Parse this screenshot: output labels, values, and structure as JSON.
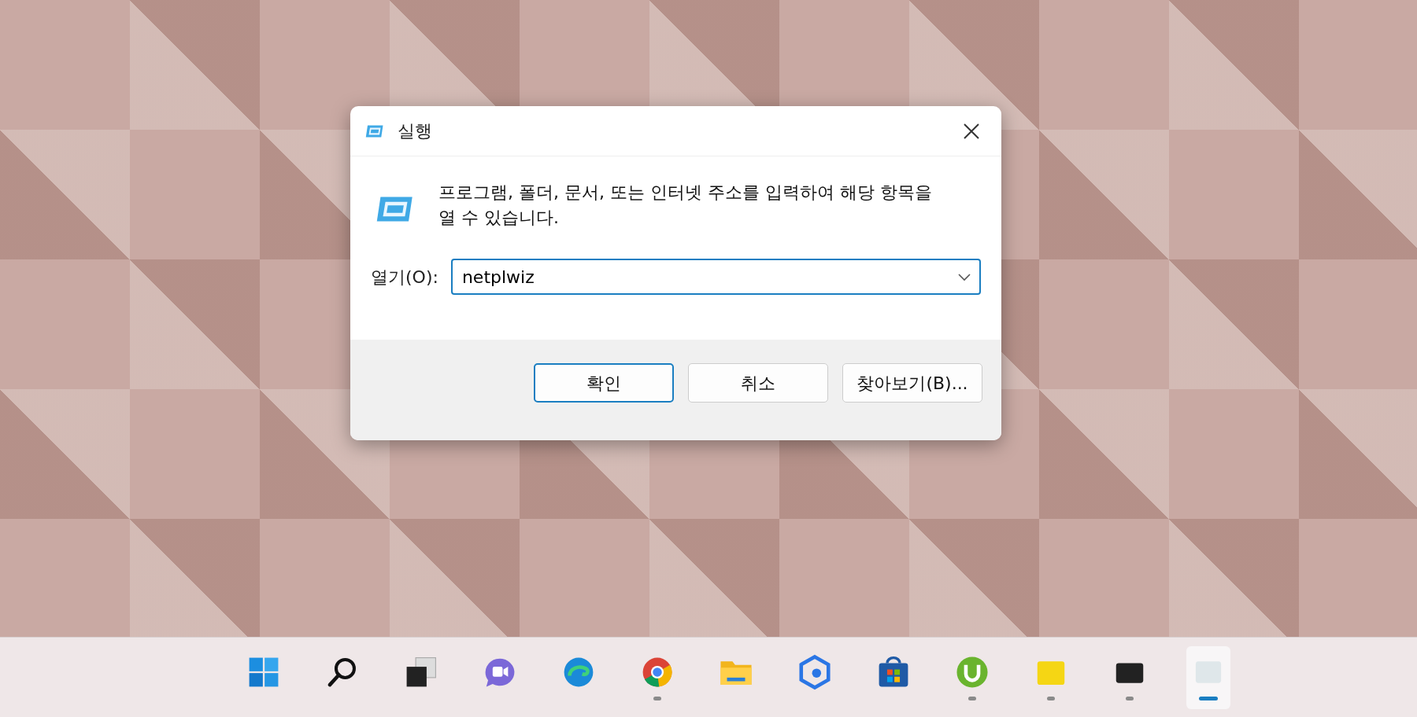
{
  "dialog": {
    "title": "실행",
    "message": "프로그램, 폴더, 문서, 또는 인터넷 주소를 입력하여 해당 항목을 열 수 있습니다.",
    "open_label": "열기(O):",
    "open_value": "netplwiz",
    "buttons": [
      {
        "label": "확인",
        "default": true
      },
      {
        "label": "취소",
        "default": false
      },
      {
        "label": "찾아보기(B)...",
        "default": false
      }
    ]
  },
  "taskbar": {
    "items": [
      {
        "kind": "start",
        "running": false,
        "active": false
      },
      {
        "kind": "search",
        "running": false,
        "active": false
      },
      {
        "kind": "taskview",
        "running": false,
        "active": false
      },
      {
        "kind": "chat",
        "running": false,
        "active": false
      },
      {
        "kind": "edge",
        "running": false,
        "active": false
      },
      {
        "kind": "chrome",
        "running": true,
        "active": false
      },
      {
        "kind": "folder",
        "running": false,
        "active": false
      },
      {
        "kind": "hexagon",
        "running": false,
        "active": false
      },
      {
        "kind": "store",
        "running": false,
        "active": false
      },
      {
        "kind": "torrent",
        "running": true,
        "active": false
      },
      {
        "kind": "yellow",
        "running": true,
        "active": false
      },
      {
        "kind": "dark",
        "running": true,
        "active": false
      },
      {
        "kind": "blank",
        "running": true,
        "active": true
      }
    ]
  }
}
